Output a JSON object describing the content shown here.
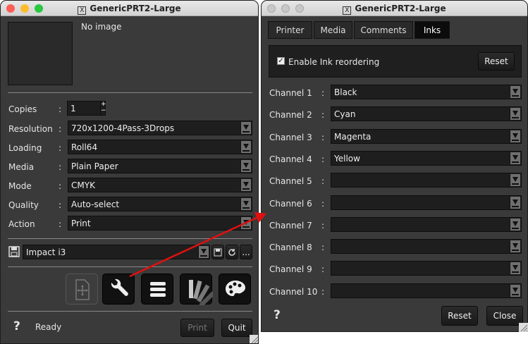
{
  "left_window": {
    "title": "GenericPRT2-Large",
    "preview_text": "No image",
    "fields": [
      {
        "label": "Copies",
        "value": "1"
      },
      {
        "label": "Resolution",
        "value": "720x1200-4Pass-3Drops"
      },
      {
        "label": "Loading",
        "value": "Roll64"
      },
      {
        "label": "Media",
        "value": "Plain Paper"
      },
      {
        "label": "Mode",
        "value": "CMYK"
      },
      {
        "label": "Quality",
        "value": "Auto-select"
      },
      {
        "label": "Action",
        "value": "Print"
      }
    ],
    "colon": ":",
    "preset": "Impact i3",
    "preset_more": "...",
    "help": "?",
    "status": "Ready",
    "print_label": "Print",
    "quit_label": "Quit"
  },
  "right_window": {
    "title": "GenericPRT2-Large",
    "tabs": [
      "Printer",
      "Media",
      "Comments",
      "Inks"
    ],
    "active_tab": "Inks",
    "enable_reorder_label": "Enable Ink reordering",
    "enable_reorder_checked": true,
    "reset_top_label": "Reset",
    "channels": [
      {
        "label": "Channel 1",
        "value": "Black"
      },
      {
        "label": "Channel 2",
        "value": "Cyan"
      },
      {
        "label": "Channel 3",
        "value": "Magenta"
      },
      {
        "label": "Channel 4",
        "value": "Yellow"
      },
      {
        "label": "Channel 5",
        "value": ""
      },
      {
        "label": "Channel 6",
        "value": ""
      },
      {
        "label": "Channel 7",
        "value": ""
      },
      {
        "label": "Channel 8",
        "value": ""
      },
      {
        "label": "Channel 9",
        "value": ""
      },
      {
        "label": "Channel 10",
        "value": ""
      }
    ],
    "help": "?",
    "reset_label": "Reset",
    "close_label": "Close"
  },
  "colors": {
    "window_bg": "#3a3a3a",
    "field_bg": "#1e1e1e",
    "arrow": "#e01010",
    "traffic_close": "#fe5f57",
    "traffic_min": "#febc2e",
    "traffic_max": "#28c840",
    "traffic_inactive": "#c8c8c8"
  },
  "icons": [
    "add-page-icon",
    "wrench-icon",
    "list-icon",
    "swatch-fan-icon",
    "palette-icon",
    "save-icon",
    "refresh-icon",
    "preset-icon",
    "checkbox-icon"
  ]
}
